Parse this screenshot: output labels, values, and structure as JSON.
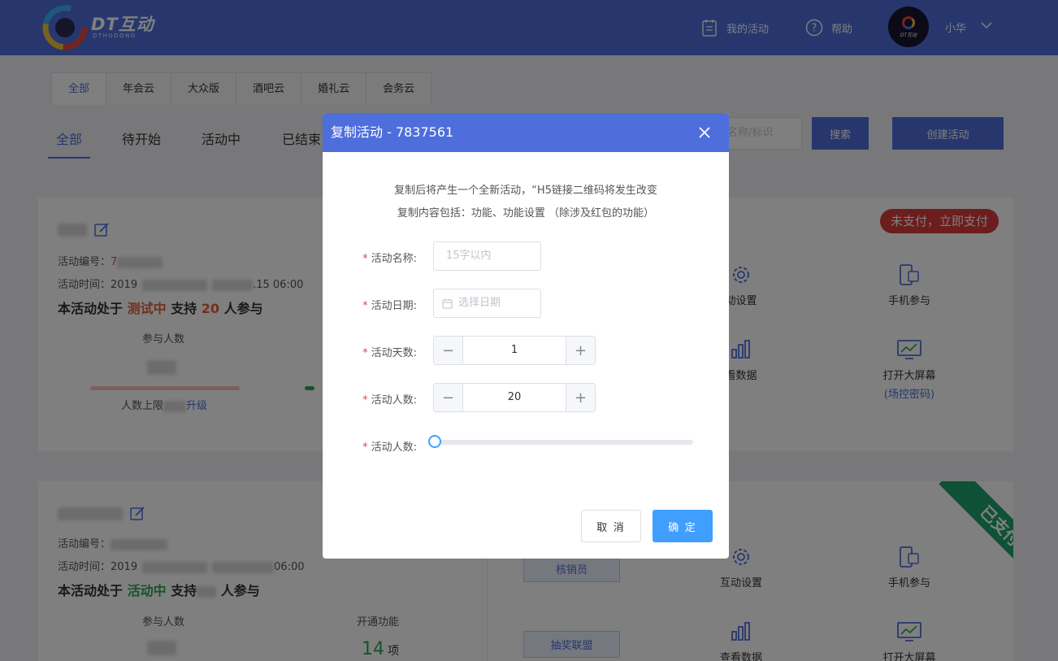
{
  "header": {
    "logo_text": "DT互动",
    "logo_sub": "DTHUDONG",
    "my_activities": "我的活动",
    "help": "帮助",
    "avatar_text": "DT互动",
    "user_name": "小华"
  },
  "category_tabs": [
    {
      "label": "全部",
      "active": true
    },
    {
      "label": "年会云"
    },
    {
      "label": "大众版"
    },
    {
      "label": "酒吧云"
    },
    {
      "label": "婚礼云"
    },
    {
      "label": "会务云"
    }
  ],
  "status_tabs": [
    {
      "label": "全部",
      "active": true
    },
    {
      "label": "待开始"
    },
    {
      "label": "活动中"
    },
    {
      "label": "已结束"
    }
  ],
  "search": {
    "placeholder": "名称/标识",
    "button": "搜索"
  },
  "create_button": "创建活动",
  "cards": [
    {
      "id_label": "活动编号：",
      "id_value": "7",
      "time_label": "活动时间：",
      "time_start": "2019",
      "time_end": ".15 06:00",
      "state_prefix": "本活动处于",
      "state": "测试中",
      "state_mid": "支持",
      "people": "20",
      "state_suffix": "人参与",
      "participants_label": "参与人数",
      "limit_label": "人数上限",
      "upgrade": "升级",
      "badge": "未支付，立即支付",
      "functions": [
        {
          "label": "动设置"
        },
        {
          "label": "手机参与"
        },
        {
          "label": "看数据"
        },
        {
          "label": "打开大屏幕",
          "sub": "(场控密码)"
        }
      ]
    },
    {
      "id_label": "活动编号：",
      "time_label": "活动时间：",
      "time_start": "2019",
      "time_end": "06:00",
      "state_prefix": "本活动处于",
      "state": "活动中",
      "state_mid": "支持",
      "state_suffix": "人参与",
      "participants_label": "参与人数",
      "enabled_label": "开通功能",
      "enabled_count": "14",
      "enabled_unit": "项",
      "ribbon": "已支付",
      "side_buttons": [
        "核销员",
        "抽奖联盟"
      ],
      "functions": [
        {
          "label": "互动设置"
        },
        {
          "label": "手机参与"
        },
        {
          "label": "查看数据"
        },
        {
          "label": "打开大屏幕"
        }
      ]
    }
  ],
  "modal": {
    "title": "复制活动 - 7837561",
    "desc_line1": "复制后将产生一个全新活动，“H5链接二维码将发生改变",
    "desc_line2": "复制内容包括：功能、功能设置 （除涉及红包的功能）",
    "fields": {
      "name_label": "活动名称:",
      "name_placeholder": "15字以内",
      "date_label": "活动日期:",
      "date_placeholder": "选择日期",
      "days_label": "活动天数:",
      "days_value": "1",
      "people_label": "活动人数:",
      "people_value": "20",
      "slider_label": "活动人数:",
      "slider_value": 0
    },
    "required_mark": "*",
    "cancel": "取 消",
    "ok": "确 定"
  },
  "colors": {
    "primary": "#4e6edc",
    "confirm": "#409eff",
    "danger": "#d93a3a",
    "paid": "#1fa36e"
  }
}
